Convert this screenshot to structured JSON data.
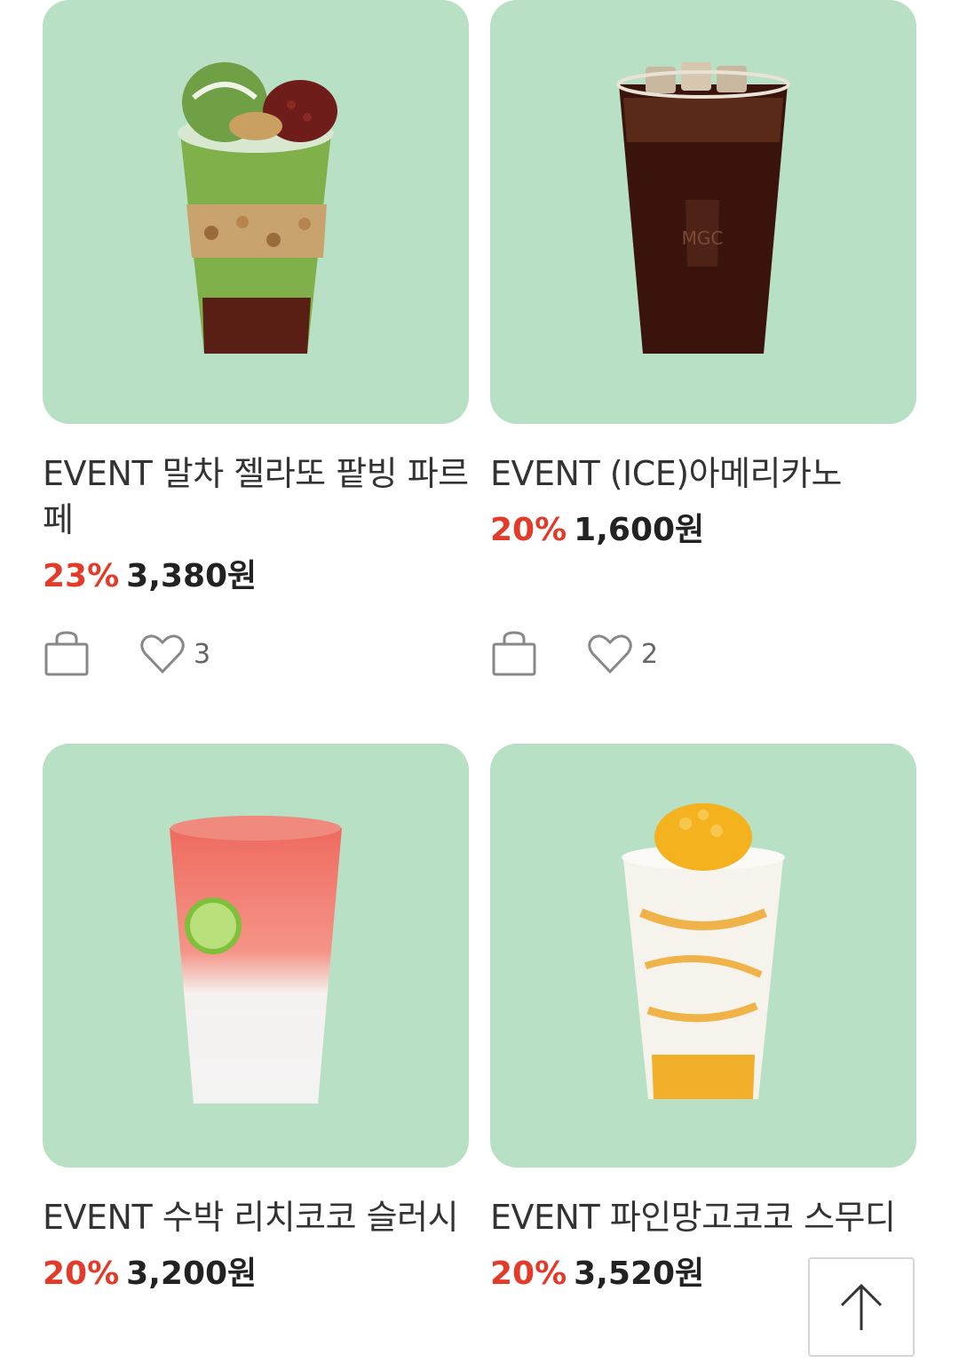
{
  "products": [
    {
      "title": "EVENT 말차 젤라또 팥빙 파르페",
      "discount": "23%",
      "price": "3,380원",
      "likes": "3"
    },
    {
      "title": "EVENT (ICE)아메리카노",
      "discount": "20%",
      "price": "1,600원",
      "likes": "2"
    },
    {
      "title": "EVENT 수박 리치코코 슬러시",
      "discount": "20%",
      "price": "3,200원"
    },
    {
      "title": "EVENT 파인망고코코 스무디",
      "discount": "20%",
      "price": "3,520원"
    }
  ],
  "icons": {
    "cart": "shopping-bag-icon",
    "like": "heart-icon",
    "scroll_top": "arrow-up-icon"
  },
  "colors": {
    "card_bg": "#b7e0c4",
    "discount": "#e23b2a"
  }
}
